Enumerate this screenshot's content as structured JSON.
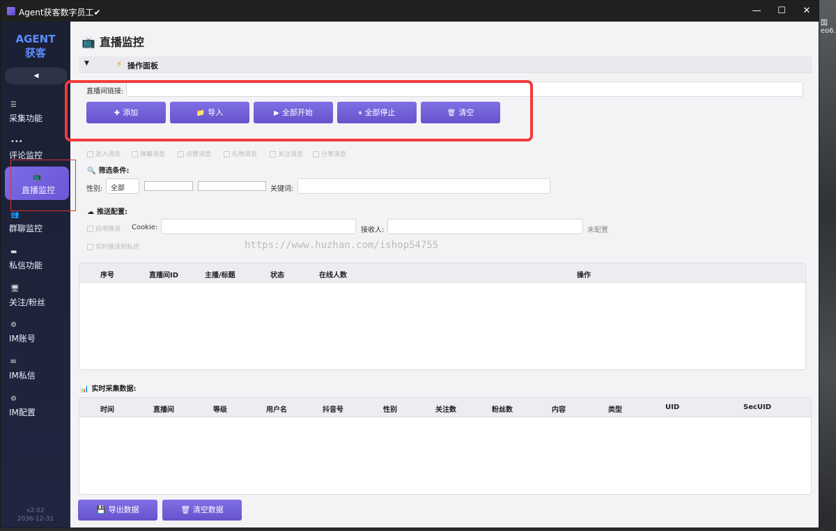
{
  "window": {
    "title": "Agent获客数字员工✔",
    "minimize": "—",
    "maximize": "☐",
    "close": "✕"
  },
  "desktop": {
    "right_text": "国\neo6.1"
  },
  "sidebar": {
    "brand_line1": "AGENT",
    "brand_line2": "获客",
    "collapse": "◀",
    "items": [
      {
        "label": "采集功能",
        "icon": "☰"
      },
      {
        "label": "评论监控",
        "icon": "•••"
      },
      {
        "label": "直播监控",
        "icon": "📺"
      },
      {
        "label": "群聊监控",
        "icon": "👥"
      },
      {
        "label": "私信功能",
        "icon": "▬"
      },
      {
        "label": "关注/粉丝",
        "icon": "🖥"
      },
      {
        "label": "IM账号",
        "icon": "⚙"
      },
      {
        "label": "IM私信",
        "icon": "✉"
      },
      {
        "label": "IM配置",
        "icon": "⚙"
      }
    ],
    "version": "v2.02",
    "date": "2036-12-31"
  },
  "main": {
    "title": "直播监控",
    "panel_toggle": "▼",
    "panel_title": "操作面板",
    "room_link_label": "直播间链接:",
    "buttons": {
      "add": "添加",
      "import": "导入",
      "start_all": "全部开始",
      "stop_all": "全部停止",
      "clear": "清空"
    },
    "checkboxes": [
      "进入消息",
      "弹幕消息",
      "点赞消息",
      "礼物消息",
      "关注消息",
      "分享消息"
    ],
    "filter": {
      "title": "筛选条件:",
      "gender_label": "性别:",
      "gender_value": "全部",
      "keyword_label": "关键词:"
    },
    "push": {
      "title": "推送配置:",
      "enable_label": "启用推送",
      "cookie_label": "Cookie:",
      "receiver_label": "接收人:",
      "status": "未配置",
      "realtime_label": "实时推送到私信"
    },
    "task_table": {
      "columns": [
        "序号",
        "直播间ID",
        "主播/标题",
        "状态",
        "在线人数",
        "操作"
      ]
    },
    "realtime": {
      "title": "实时采集数据:",
      "columns": [
        "时间",
        "直播间",
        "等级",
        "用户名",
        "抖音号",
        "性别",
        "关注数",
        "粉丝数",
        "内容",
        "类型",
        "UID",
        "SecUID"
      ]
    },
    "export_button": "导出数据",
    "clear_data_button": "清空数据",
    "watermark": "https://www.huzhan.com/ishop54755"
  }
}
